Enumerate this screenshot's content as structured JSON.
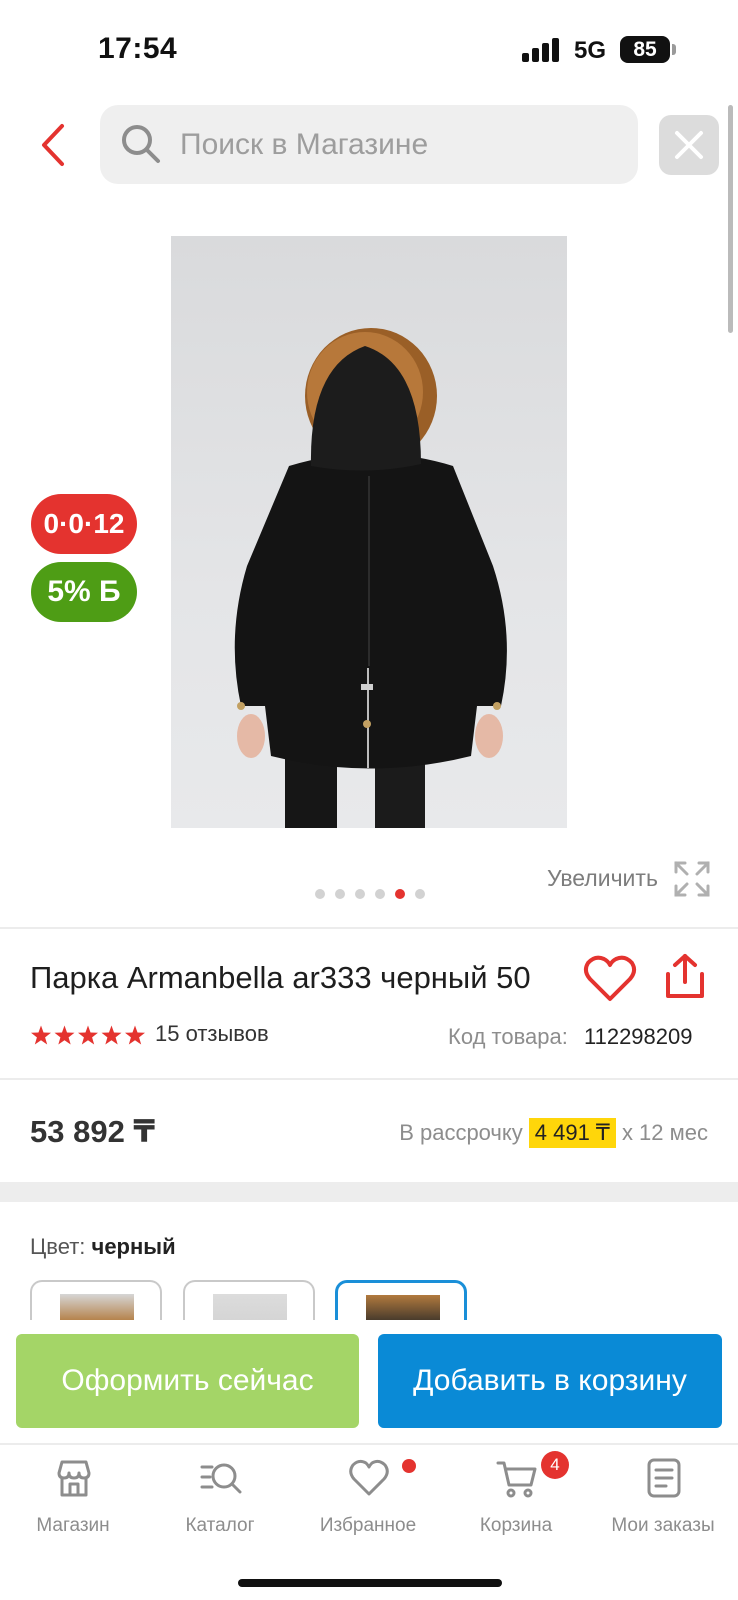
{
  "status_bar": {
    "time": "17:54",
    "network": "5G",
    "battery": "85"
  },
  "search": {
    "placeholder": "Поиск в Магазине",
    "value": ""
  },
  "product": {
    "badges": {
      "installment": "0·0·12",
      "bonus": "5% Б"
    },
    "zoom_label": "Увеличить",
    "gallery": {
      "total_images": 6,
      "active_index": 4
    },
    "title": "Парка Armanbella ar333 черный 50",
    "rating": 5,
    "reviews": "15 отзывов",
    "code_label": "Код товара:",
    "code_value": "112298209",
    "price": "53 892 ₸",
    "installment_prefix": "В рассрочку",
    "installment_amount": "4 491 ₸",
    "installment_suffix": "x 12 мес",
    "color_label": "Цвет:",
    "color_value": "черный",
    "color_options": [
      {
        "name": "variant-1",
        "selected": false
      },
      {
        "name": "variant-2",
        "selected": false
      },
      {
        "name": "variant-3",
        "selected": true
      }
    ]
  },
  "actions": {
    "buy_now": "Оформить сейчас",
    "add_to_cart": "Добавить в корзину"
  },
  "nav": {
    "items": [
      {
        "label": "Магазин",
        "icon": "store-icon"
      },
      {
        "label": "Каталог",
        "icon": "catalog-search-icon"
      },
      {
        "label": "Избранное",
        "icon": "heart-icon"
      },
      {
        "label": "Корзина",
        "icon": "cart-icon"
      },
      {
        "label": "Мои заказы",
        "icon": "orders-icon"
      }
    ],
    "cart_count": "4"
  },
  "colors": {
    "accent_red": "#e4332f",
    "bonus_green": "#4e9d15",
    "buy_green": "#a4d567",
    "cart_blue": "#0a8ad6",
    "installment_yellow": "#ffd60a"
  }
}
